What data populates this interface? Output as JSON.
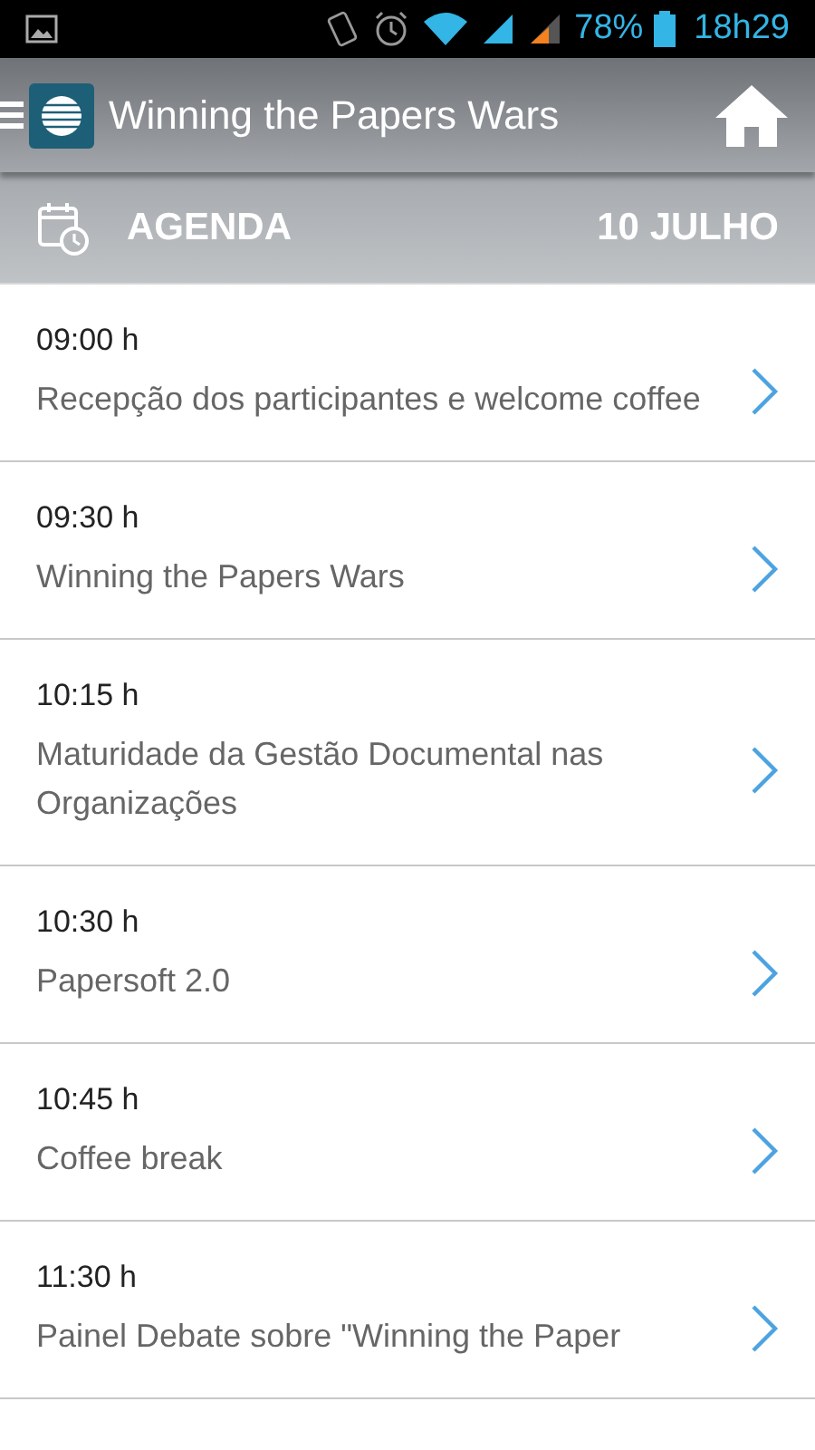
{
  "status_bar": {
    "battery": "78%",
    "time": "18h29"
  },
  "app_bar": {
    "title": "Winning the Papers Wars"
  },
  "section": {
    "title": "AGENDA",
    "date": "10 JULHO"
  },
  "agenda": [
    {
      "time": "09:00 h",
      "title": "Recepção dos participantes e welcome coffee"
    },
    {
      "time": "09:30 h",
      "title": "Winning the Papers Wars"
    },
    {
      "time": "10:15 h",
      "title": "Maturidade da Gestão Documental nas Organizações"
    },
    {
      "time": "10:30 h",
      "title": "Papersoft 2.0"
    },
    {
      "time": "10:45 h",
      "title": "Coffee break"
    },
    {
      "time": "11:30 h",
      "title": "Painel Debate sobre \"Winning the Paper"
    }
  ]
}
